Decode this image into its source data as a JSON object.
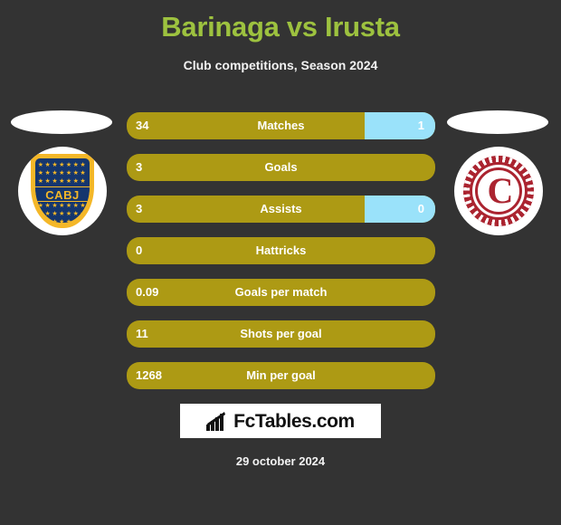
{
  "header": {
    "title": "Barinaga vs Irusta",
    "subtitle": "Club competitions, Season 2024",
    "title_color": "#9DC23F"
  },
  "teams": {
    "home": {
      "badge_name": "boca-juniors-crest",
      "badge_text": "CABJ",
      "colors": {
        "primary": "#15366E",
        "accent": "#F4B728"
      }
    },
    "away": {
      "badge_name": "lanus-crest",
      "badge_text": "C",
      "colors": {
        "primary": "#AB2430",
        "accent": "#FFFFFF"
      }
    }
  },
  "colors": {
    "background": "#333333",
    "bar_home": "#AD9A14",
    "bar_away": "#9AE2FA",
    "text": "#FFFFFF"
  },
  "stats": [
    {
      "label": "Matches",
      "left": "34",
      "right": "1",
      "left_pct": 77,
      "right_pct": 23
    },
    {
      "label": "Goals",
      "left": "3",
      "right": "",
      "left_pct": 100,
      "right_pct": 0
    },
    {
      "label": "Assists",
      "left": "3",
      "right": "0",
      "left_pct": 77,
      "right_pct": 23
    },
    {
      "label": "Hattricks",
      "left": "0",
      "right": "",
      "left_pct": 100,
      "right_pct": 0
    },
    {
      "label": "Goals per match",
      "left": "0.09",
      "right": "",
      "left_pct": 100,
      "right_pct": 0
    },
    {
      "label": "Shots per goal",
      "left": "11",
      "right": "",
      "left_pct": 100,
      "right_pct": 0
    },
    {
      "label": "Min per goal",
      "left": "1268",
      "right": "",
      "left_pct": 100,
      "right_pct": 0
    }
  ],
  "footer": {
    "brand": "FcTables.com",
    "brand_icon": "bar-chart-icon",
    "date": "29 october 2024"
  }
}
